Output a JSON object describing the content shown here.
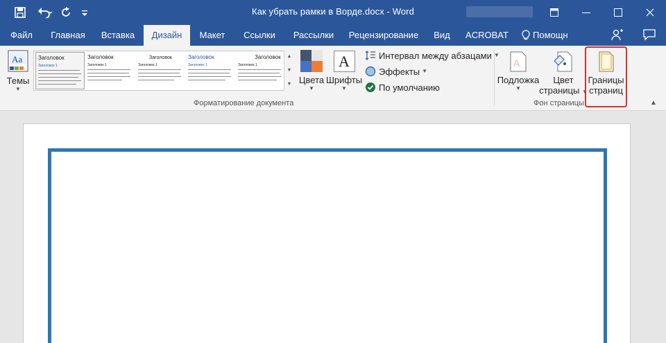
{
  "window": {
    "title": "Как убрать рамки в Ворде.docx - Word",
    "minimize_label": "—",
    "maximize_label": "□",
    "close_label": "✕"
  },
  "quick_access": {
    "save_icon": "save-icon",
    "undo_icon": "undo-icon",
    "redo_icon": "redo-icon",
    "customize_icon": "customize-qat-icon"
  },
  "tabs": [
    {
      "label": "Файл",
      "active": false
    },
    {
      "label": "Главная",
      "active": false
    },
    {
      "label": "Вставка",
      "active": false
    },
    {
      "label": "Дизайн",
      "active": true
    },
    {
      "label": "Макет",
      "active": false
    },
    {
      "label": "Ссылки",
      "active": false
    },
    {
      "label": "Рассылки",
      "active": false
    },
    {
      "label": "Рецензирование",
      "active": false
    },
    {
      "label": "Вид",
      "active": false
    },
    {
      "label": "ACROBAT",
      "active": false
    }
  ],
  "tell_me": "Помощн",
  "ribbon": {
    "themes_label": "Темы",
    "gallery": [
      {
        "heading": "Заголовок",
        "subheading": "Заголовок 1"
      },
      {
        "heading": "Заголовок",
        "subheading": "Заголовок 1"
      },
      {
        "heading": "Заголовок",
        "subheading": "Заголовок 1"
      },
      {
        "heading": "Заголовок",
        "subheading": "Заголовок 1"
      },
      {
        "heading": "Заголовок",
        "subheading": "Заголовок 1"
      }
    ],
    "colors_label": "Цвета",
    "fonts_label": "Шрифты",
    "fonts_glyph": "A",
    "paragraph_spacing_label": "Интервал между абзацами",
    "effects_label": "Эффекты",
    "set_default_label": "По умолчанию",
    "document_formatting_group": "Форматирование документа",
    "watermark_label": "Подложка",
    "page_color_label_1": "Цвет",
    "page_color_label_2": "страницы",
    "page_borders_label_1": "Границы",
    "page_borders_label_2": "страниц",
    "page_background_group": "Фон страницы"
  },
  "colors": {
    "title_bar": "#2b579a",
    "highlight": "#d9302c",
    "page_border": "#2e75b6"
  }
}
